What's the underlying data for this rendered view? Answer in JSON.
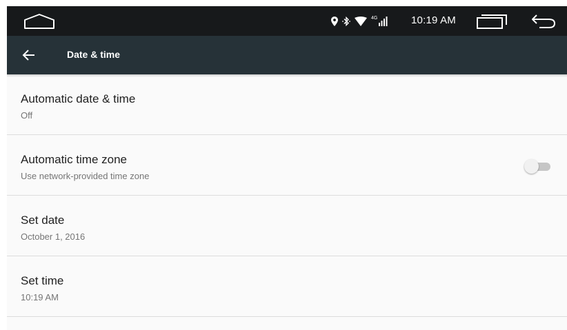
{
  "status_bar": {
    "time": "10:19 AM",
    "icons": [
      "location-icon",
      "bluetooth-icon",
      "wifi-icon",
      "4g-icon",
      "cell-signal-icon"
    ],
    "network_label": "4G"
  },
  "nav": {
    "home_icon": "home-icon",
    "recents_icon": "recents-icon",
    "back_icon": "back-icon"
  },
  "toolbar": {
    "title": "Date & time",
    "back_icon": "arrow-back-icon",
    "background": "#263238"
  },
  "settings": [
    {
      "title": "Automatic date & time",
      "summary": "Off"
    },
    {
      "title": "Automatic time zone",
      "summary": "Use network-provided time zone",
      "toggle_on": false
    },
    {
      "title": "Set date",
      "summary": "October 1, 2016"
    },
    {
      "title": "Set time",
      "summary": "10:19 AM"
    }
  ],
  "colors": {
    "status_bar": "#17191b",
    "toolbar": "#263238",
    "background": "#fafafa",
    "title_text": "#212121",
    "summary_text": "#757575"
  }
}
